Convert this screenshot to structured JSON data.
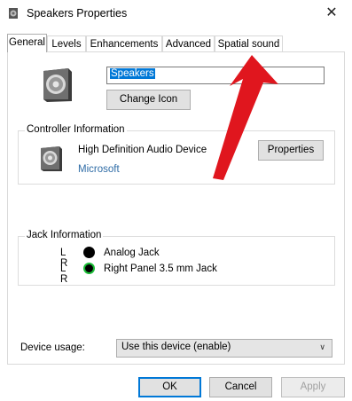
{
  "window": {
    "title": "Speakers Properties",
    "app_icon": "speaker-icon",
    "close_glyph": "✕"
  },
  "tabs": [
    {
      "label": "General",
      "active": true
    },
    {
      "label": "Levels",
      "active": false
    },
    {
      "label": "Enhancements",
      "active": false
    },
    {
      "label": "Advanced",
      "active": false
    },
    {
      "label": "Spatial sound",
      "active": false
    }
  ],
  "general": {
    "device_name_value": "Speakers",
    "change_icon_label": "Change Icon"
  },
  "controller": {
    "section_title": "Controller Information",
    "device": "High Definition Audio Device",
    "vendor": "Microsoft",
    "properties_label": "Properties"
  },
  "jack": {
    "section_title": "Jack Information",
    "rows": [
      {
        "channels": "L R",
        "label": "Analog Jack",
        "color": "#000000"
      },
      {
        "channels": "L R",
        "label": "Right Panel 3.5 mm Jack",
        "color": "#1bbd37"
      }
    ]
  },
  "usage": {
    "label": "Device usage:",
    "selected": "Use this device (enable)"
  },
  "buttons": {
    "ok": "OK",
    "cancel": "Cancel",
    "apply": "Apply"
  },
  "colors": {
    "accent": "#0078d7",
    "annotation_arrow": "#e0161e"
  }
}
